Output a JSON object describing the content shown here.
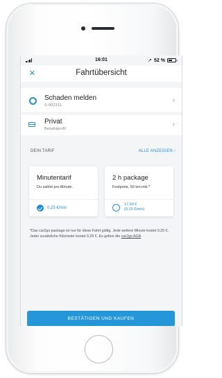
{
  "status_bar": {
    "time": "16:01",
    "battery": "52 %"
  },
  "header": {
    "close_glyph": "×",
    "title": "Fahrtübersicht"
  },
  "rows": [
    {
      "icon": "ring-icon",
      "title": "Schaden melden",
      "subtitle": "S-002211",
      "chevron": "›"
    },
    {
      "icon": "credit-card-icon",
      "title": "Privat",
      "subtitle": "Bezahlprofil",
      "chevron": "›"
    }
  ],
  "tarif": {
    "label": "DEIN TARIF",
    "show_all": "ALLE ANZEIGEN  ›",
    "cards": [
      {
        "name": "Minutentarif",
        "description": "Du zahlst pro Minute.",
        "price": "0,25 €/min",
        "selected": true
      },
      {
        "name": "2 h package",
        "description": "Festpreis, 50 km inkl.*",
        "price_line1": "17,90 €",
        "price_line2": "(0,15 €/min)",
        "selected": false
      }
    ]
  },
  "footnote": {
    "text": "*Das car2go package ist nur für diese Fahrt gültig. Jede weitere Minute kostet 0,25 €. Jeder zusätzliche Kilometer kostet 0,29 €. Es gelten die ",
    "link": "car2go AGB",
    "end": "."
  },
  "cta": {
    "label": "BESTÄTIGEN UND KAUFEN"
  },
  "colors": {
    "accent": "#1f8fd8",
    "button": "#2596d8",
    "screen_bg": "#f4f5f7"
  }
}
